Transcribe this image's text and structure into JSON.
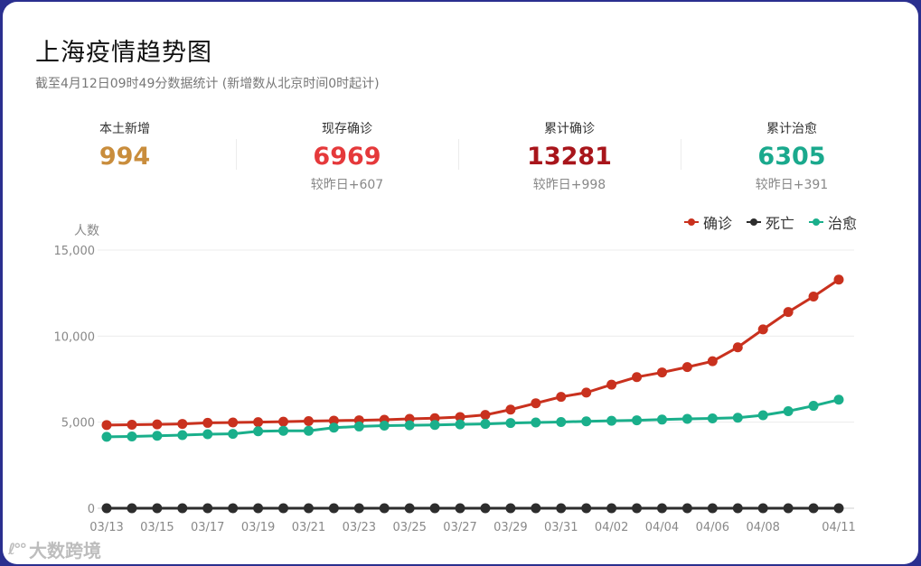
{
  "header": {
    "title": "上海疫情趋势图",
    "subtitle": "截至4月12日09时49分数据统计 (新增数从北京时间0时起计)"
  },
  "stats": [
    {
      "label": "本土新增",
      "value": "994",
      "change": "",
      "color": "#c98d3c"
    },
    {
      "label": "现存确诊",
      "value": "6969",
      "change": "较昨日+607",
      "color": "#e5393b"
    },
    {
      "label": "累计确诊",
      "value": "13281",
      "change": "较昨日+998",
      "color": "#a8151b"
    },
    {
      "label": "累计治愈",
      "value": "6305",
      "change": "较昨日+391",
      "color": "#1aa98d"
    }
  ],
  "watermark": {
    "logo": "ℓ°°",
    "text": "大数跨境"
  },
  "chart_data": {
    "type": "line",
    "ylabel": "人数",
    "ylim": [
      0,
      15000
    ],
    "yticks": [
      0,
      5000,
      10000,
      15000
    ],
    "ytick_labels": [
      "0",
      "5,000",
      "10,000",
      "15,000"
    ],
    "legend_position": "top-right",
    "x": [
      "03/13",
      "03/14",
      "03/15",
      "03/16",
      "03/17",
      "03/18",
      "03/19",
      "03/20",
      "03/21",
      "03/22",
      "03/23",
      "03/24",
      "03/25",
      "03/26",
      "03/27",
      "03/28",
      "03/29",
      "03/30",
      "03/31",
      "04/01",
      "04/02",
      "04/03",
      "04/04",
      "04/05",
      "04/06",
      "04/07",
      "04/08",
      "04/09",
      "04/10",
      "04/11"
    ],
    "xtick_labels": [
      "03/13",
      "03/15",
      "03/17",
      "03/19",
      "03/21",
      "03/23",
      "03/25",
      "03/27",
      "03/29",
      "03/31",
      "04/02",
      "04/04",
      "04/06",
      "04/08",
      "04/11"
    ],
    "series": [
      {
        "name": "确诊",
        "color": "#c9311e",
        "values": [
          4835,
          4850,
          4870,
          4900,
          4960,
          4980,
          5000,
          5030,
          5060,
          5090,
          5110,
          5140,
          5190,
          5230,
          5300,
          5420,
          5730,
          6100,
          6470,
          6720,
          7180,
          7620,
          7890,
          8200,
          8540,
          9350,
          10390,
          11400,
          12300,
          13281
        ]
      },
      {
        "name": "死亡",
        "color": "#2d2d2d",
        "values": [
          0,
          0,
          0,
          0,
          0,
          0,
          0,
          0,
          0,
          0,
          0,
          0,
          0,
          0,
          0,
          0,
          0,
          0,
          0,
          0,
          0,
          0,
          0,
          0,
          0,
          0,
          0,
          0,
          0,
          0
        ]
      },
      {
        "name": "治愈",
        "color": "#1aaf8b",
        "values": [
          4150,
          4170,
          4210,
          4250,
          4300,
          4320,
          4470,
          4500,
          4500,
          4680,
          4750,
          4800,
          4820,
          4840,
          4870,
          4900,
          4950,
          4980,
          5010,
          5050,
          5080,
          5110,
          5150,
          5190,
          5220,
          5260,
          5400,
          5640,
          5950,
          6305
        ]
      }
    ]
  }
}
